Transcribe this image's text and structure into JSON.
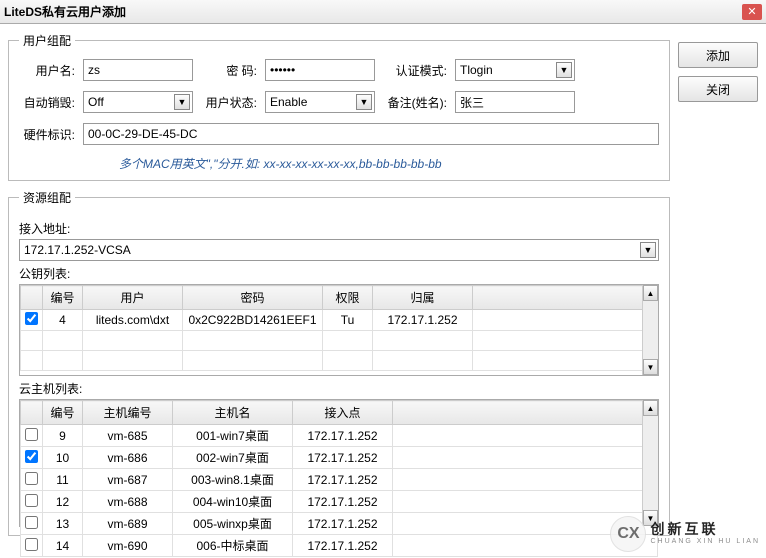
{
  "window": {
    "title": "LiteDS私有云用户添加"
  },
  "buttons": {
    "add": "添加",
    "close": "关闭"
  },
  "user_group": {
    "legend": "用户组配",
    "username_label": "用户名:",
    "username": "zs",
    "password_label": "密  码:",
    "password": "••••••",
    "authmode_label": "认证模式:",
    "authmode": "Tlogin",
    "autodestroy_label": "自动销毁:",
    "autodestroy": "Off",
    "userstatus_label": "用户状态:",
    "userstatus": "Enable",
    "remark_label": "备注(姓名):",
    "remark": "张三",
    "hwid_label": "硬件标识:",
    "hwid": "00-0C-29-DE-45-DC",
    "hint": "多个MAC用英文\",\"分开.如:  xx-xx-xx-xx-xx-xx,bb-bb-bb-bb-bb"
  },
  "resource_group": {
    "legend": "资源组配",
    "access_label": "接入地址:",
    "access_value": "172.17.1.252-VCSA",
    "pubkey_label": "公钥列表:",
    "pubkey_cols": {
      "no": "编号",
      "user": "用户",
      "pwd": "密码",
      "perm": "权限",
      "owner": "归属"
    },
    "pubkey_rows": [
      {
        "checked": true,
        "no": "4",
        "user": "liteds.com\\dxt",
        "pwd": "0x2C922BD14261EEF1",
        "perm": "Tu",
        "owner": "172.17.1.252"
      }
    ],
    "vm_label": "云主机列表:",
    "vm_cols": {
      "no": "编号",
      "hostno": "主机编号",
      "hostname": "主机名",
      "access": "接入点"
    },
    "vm_rows": [
      {
        "checked": false,
        "no": "9",
        "hostno": "vm-685",
        "hostname": "001-win7桌面",
        "access": "172.17.1.252"
      },
      {
        "checked": true,
        "no": "10",
        "hostno": "vm-686",
        "hostname": "002-win7桌面",
        "access": "172.17.1.252"
      },
      {
        "checked": false,
        "no": "11",
        "hostno": "vm-687",
        "hostname": "003-win8.1桌面",
        "access": "172.17.1.252"
      },
      {
        "checked": false,
        "no": "12",
        "hostno": "vm-688",
        "hostname": "004-win10桌面",
        "access": "172.17.1.252"
      },
      {
        "checked": false,
        "no": "13",
        "hostno": "vm-689",
        "hostname": "005-winxp桌面",
        "access": "172.17.1.252"
      },
      {
        "checked": false,
        "no": "14",
        "hostno": "vm-690",
        "hostname": "006-中标桌面",
        "access": "172.17.1.252"
      }
    ]
  },
  "watermark": {
    "brand_cn": "创新互联",
    "brand_en": "CHUANG XIN HU LIAN",
    "logo_text": "CX"
  }
}
